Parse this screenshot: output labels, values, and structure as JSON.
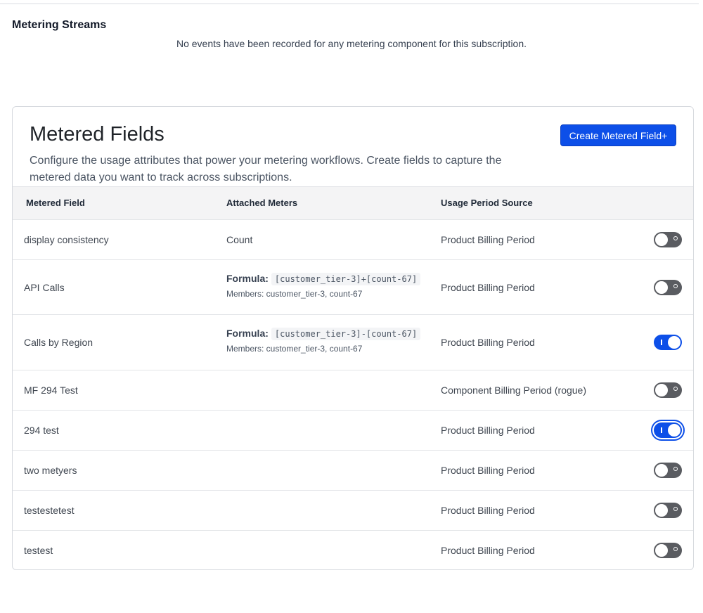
{
  "streams": {
    "title": "Metering Streams",
    "empty_message": "No events have been recorded for any metering component for this subscription."
  },
  "metered_fields": {
    "title": "Metered Fields",
    "description": "Configure the usage attributes that power your metering workflows. Create fields to capture the metered data you want to track across subscriptions.",
    "create_button_label": "Create Metered Field+",
    "columns": [
      "Metered Field",
      "Attached Meters",
      "Usage Period Source"
    ],
    "formula_label": "Formula:",
    "rows": [
      {
        "name": "display consistency",
        "meters": "Count",
        "formula": "",
        "members": "",
        "period": "Product Billing Period",
        "enabled": false
      },
      {
        "name": "API Calls",
        "meters": "",
        "formula": "[customer_tier-3]+[count-67]",
        "members": "Members: customer_tier-3, count-67",
        "period": "Product Billing Period",
        "enabled": false
      },
      {
        "name": "Calls by Region",
        "meters": "",
        "formula": "[customer_tier-3]-[count-67]",
        "members": "Members: customer_tier-3, count-67",
        "period": "Product Billing Period",
        "enabled": true
      },
      {
        "name": "MF 294 Test",
        "meters": "",
        "formula": "",
        "members": "",
        "period": "Component Billing Period (rogue)",
        "enabled": false
      },
      {
        "name": "294 test",
        "meters": "",
        "formula": "",
        "members": "",
        "period": "Product Billing Period",
        "enabled": true
      },
      {
        "name": "two metyers",
        "meters": "",
        "formula": "",
        "members": "",
        "period": "Product Billing Period",
        "enabled": false
      },
      {
        "name": "testestetest",
        "meters": "",
        "formula": "",
        "members": "",
        "period": "Product Billing Period",
        "enabled": false
      },
      {
        "name": "testest",
        "meters": "",
        "formula": "",
        "members": "",
        "period": "Product Billing Period",
        "enabled": false
      }
    ]
  },
  "colors": {
    "accent": "#0d4fe8",
    "toggle_off": "#5a5c61"
  }
}
